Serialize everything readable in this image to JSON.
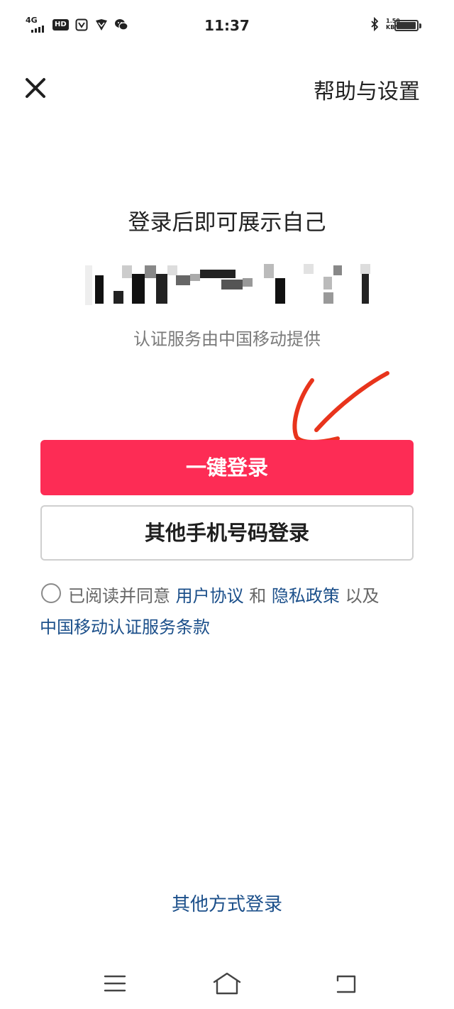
{
  "status_bar": {
    "network": "4G",
    "hd_badge": "HD",
    "time": "11:37",
    "speed_value": "1.50",
    "speed_unit": "KB/s",
    "icons": [
      "signal-icon",
      "screen-mirror-icon",
      "vpn-shield-icon",
      "wechat-icon",
      "bluetooth-icon",
      "battery-icon"
    ],
    "battery_level": 0.95
  },
  "top_bar": {
    "close_icon": "close-icon",
    "help_label": "帮助与设置"
  },
  "main": {
    "headline": "登录后即可展示自己",
    "provider_text": "认证服务由中国移动提供",
    "one_click_label": "一键登录",
    "other_phone_label": "其他手机号码登录"
  },
  "agreement": {
    "prefix": "已阅读并同意",
    "user_agreement": "用户协议",
    "and": "和",
    "privacy_policy": "隐私政策",
    "also": "以及",
    "cmcc_terms": "中国移动认证服务条款",
    "checked": false
  },
  "footer": {
    "other_method_label": "其他方式登录"
  },
  "nav_bar": {
    "icons": [
      "menu-icon",
      "home-icon",
      "back-icon"
    ]
  },
  "colors": {
    "primary": "#fd2c55",
    "link": "#1b4f8a",
    "annotation": "#e8341c"
  }
}
